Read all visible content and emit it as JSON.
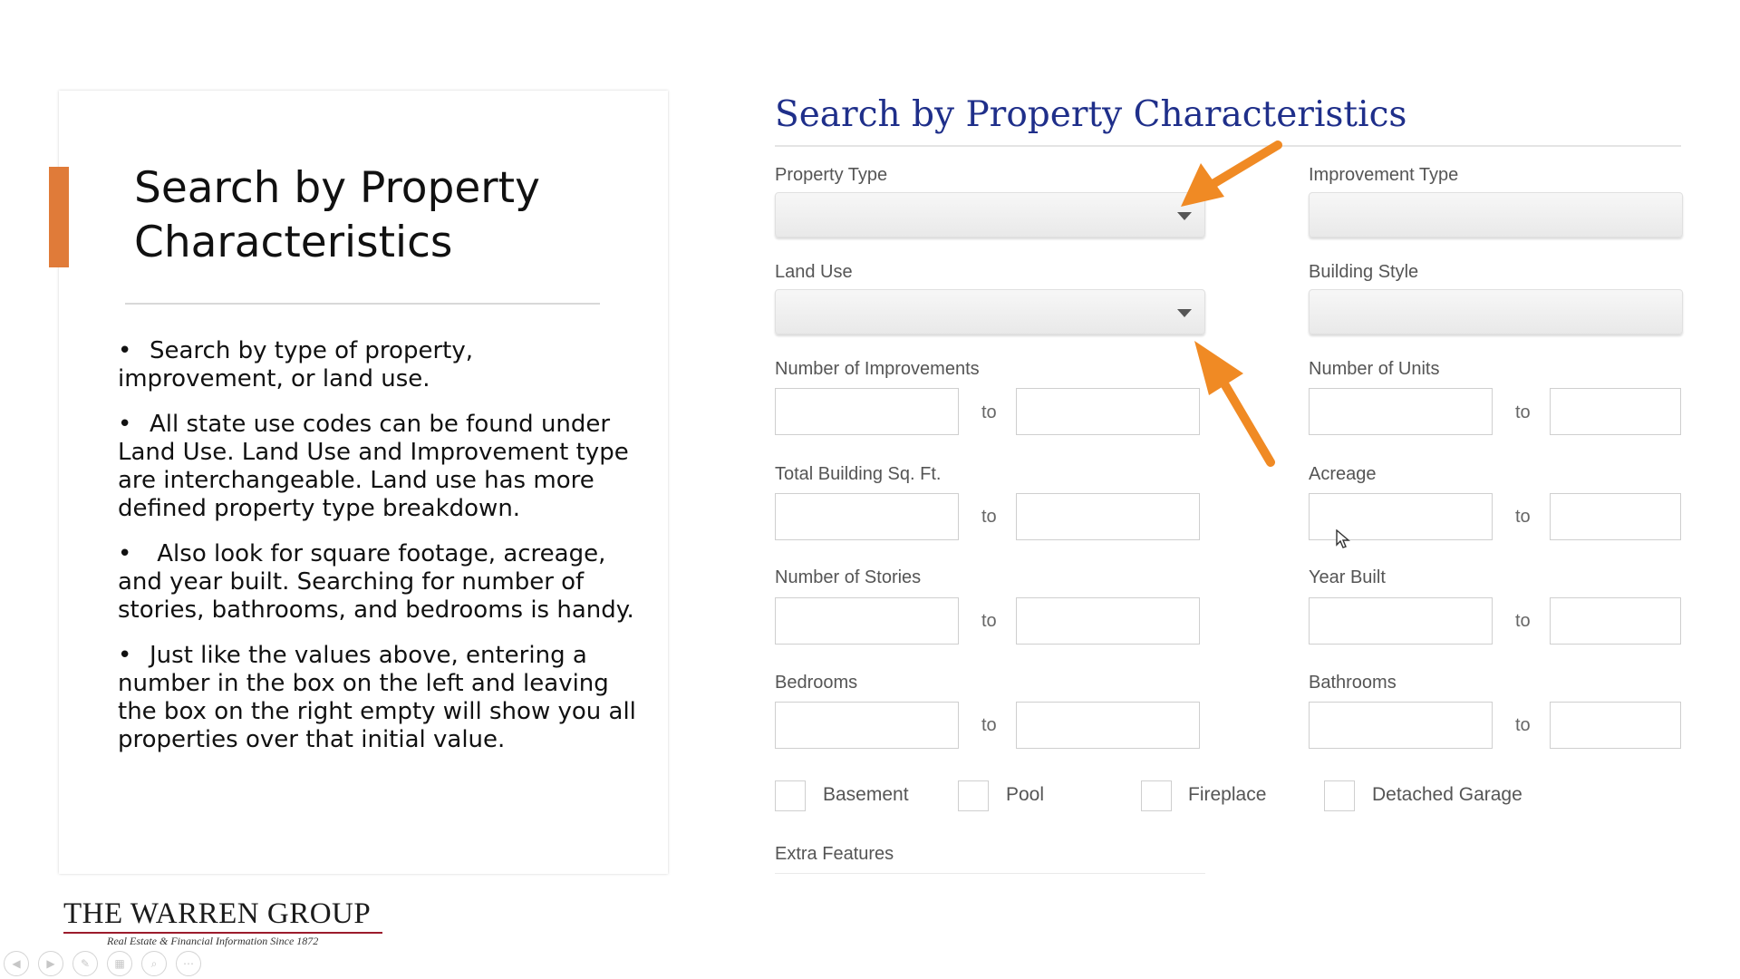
{
  "slide": {
    "title": "Search by Property Characteristics",
    "bullets": [
      "Search by type of property, improvement, or land use.",
      "All state use codes can be found under Land Use.  Land Use and Improvement type are interchangeable.  Land use has more defined property type breakdown.",
      " Also look for square footage, acreage, and year built. Searching for number of stories, bathrooms, and bedrooms is handy.",
      "Just like the values above, entering a number in the box on the left and leaving the box on the right empty will show you all properties over that initial value."
    ],
    "bullet_symbol": "•",
    "accent_color": "#e07b39"
  },
  "logo": {
    "name": "THE WARREN GROUP",
    "tagline": "Real Estate & Financial Information Since 1872"
  },
  "form": {
    "title": "Search by Property Characteristics",
    "title_color": "#1f2f8a",
    "range_separator": "to",
    "labels": {
      "property_type": "Property Type",
      "improvement_type": "Improvement Type",
      "land_use": "Land Use",
      "building_style": "Building Style",
      "num_improvements": "Number of Improvements",
      "num_units": "Number of Units",
      "total_sqft": "Total Building Sq. Ft.",
      "acreage": "Acreage",
      "num_stories": "Number of Stories",
      "year_built": "Year Built",
      "bedrooms": "Bedrooms",
      "bathrooms": "Bathrooms",
      "extra_features": "Extra Features"
    },
    "checkboxes": {
      "basement": "Basement",
      "pool": "Pool",
      "fireplace": "Fireplace",
      "detached_garage": "Detached Garage"
    },
    "annotation_arrow_color": "#f08a24"
  },
  "icons": {
    "caret": "chevron-down-icon",
    "cursor": "mouse-pointer-icon",
    "toolbar": [
      "previous-icon",
      "next-icon",
      "pen-icon",
      "slides-icon",
      "zoom-icon",
      "more-icon"
    ]
  }
}
